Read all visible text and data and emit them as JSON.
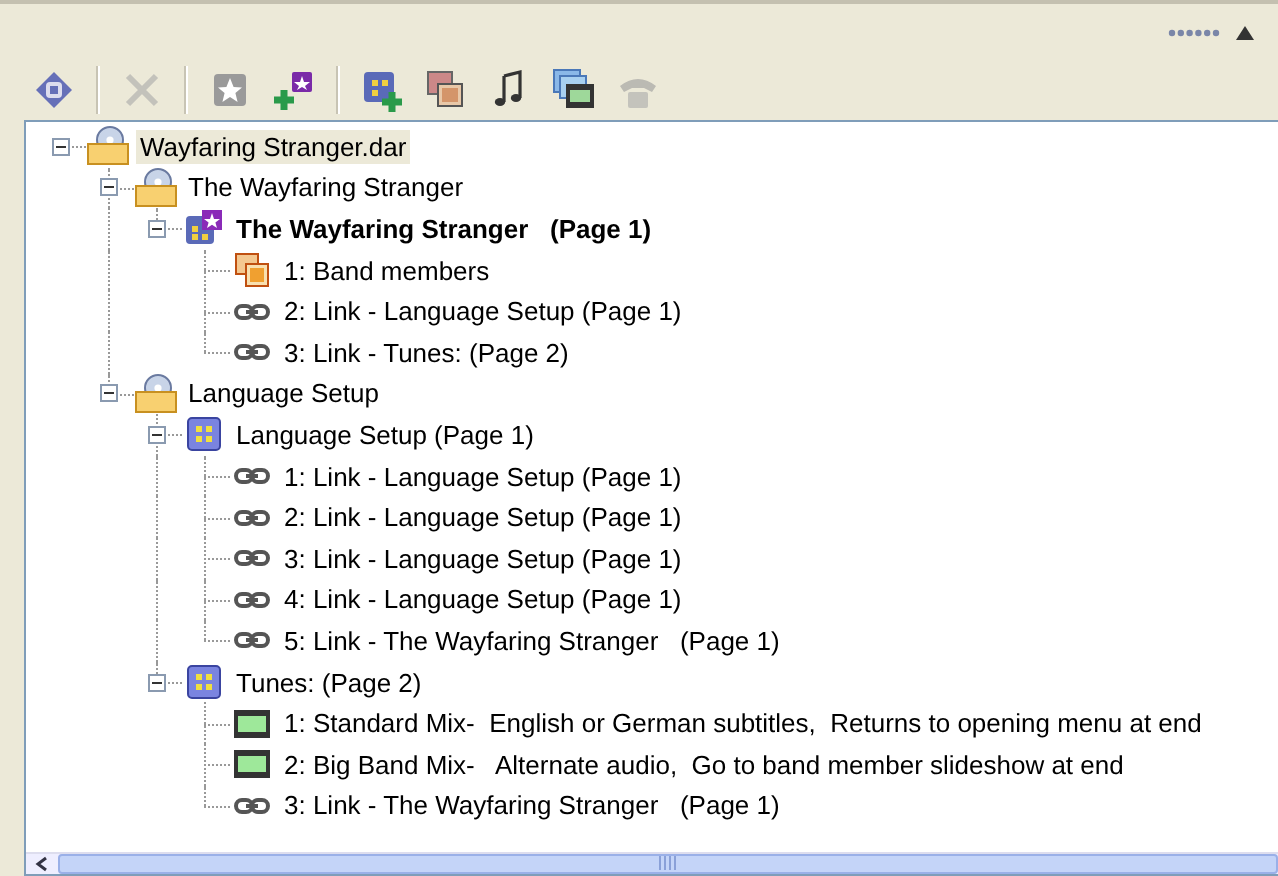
{
  "toolbar": [
    {
      "kind": "target",
      "disabled": false
    },
    {
      "kind": "separator"
    },
    {
      "kind": "delete",
      "disabled": true
    },
    {
      "kind": "separator"
    },
    {
      "kind": "star",
      "disabled": false
    },
    {
      "kind": "add-menu",
      "disabled": false
    },
    {
      "kind": "separator"
    },
    {
      "kind": "add-page",
      "disabled": false
    },
    {
      "kind": "slides",
      "disabled": false
    },
    {
      "kind": "music",
      "disabled": false
    },
    {
      "kind": "movies",
      "disabled": false
    },
    {
      "kind": "phone",
      "disabled": true
    }
  ],
  "tree": [
    {
      "kind": "disc-folder",
      "label": "Wayfaring Stranger.dar",
      "selected": true,
      "expanded": true,
      "children": [
        {
          "kind": "disc-folder",
          "label": "The Wayfaring Stranger",
          "selected": false,
          "expanded": true,
          "children": [
            {
              "kind": "start-menu",
              "label": "The Wayfaring Stranger   (Page 1)",
              "selected": false,
              "expanded": true,
              "children": [
                {
                  "kind": "slideshow",
                  "label": "1: Band members",
                  "selected": false
                },
                {
                  "kind": "link",
                  "label": "2: Link - Language Setup (Page 1)",
                  "selected": false
                },
                {
                  "kind": "link",
                  "label": "3: Link - Tunes: (Page 2)",
                  "selected": false
                }
              ]
            }
          ]
        },
        {
          "kind": "disc-folder",
          "label": "Language Setup",
          "selected": false,
          "expanded": true,
          "children": [
            {
              "kind": "menu",
              "label": "Language Setup (Page 1)",
              "selected": false,
              "expanded": true,
              "children": [
                {
                  "kind": "link",
                  "label": "1: Link - Language Setup (Page 1)",
                  "selected": false
                },
                {
                  "kind": "link",
                  "label": "2: Link - Language Setup (Page 1)",
                  "selected": false
                },
                {
                  "kind": "link",
                  "label": "3: Link - Language Setup (Page 1)",
                  "selected": false
                },
                {
                  "kind": "link",
                  "label": "4: Link - Language Setup (Page 1)",
                  "selected": false
                },
                {
                  "kind": "link",
                  "label": "5: Link - The Wayfaring Stranger   (Page 1)",
                  "selected": false
                }
              ]
            },
            {
              "kind": "menu",
              "label": "Tunes: (Page 2)",
              "selected": false,
              "expanded": true,
              "children": [
                {
                  "kind": "movie",
                  "label": "1: Standard Mix-  English or German subtitles,  Returns to opening menu at end",
                  "selected": false
                },
                {
                  "kind": "movie",
                  "label": "2: Big Band Mix-   Alternate audio,  Go to band member slideshow at end",
                  "selected": false
                },
                {
                  "kind": "link",
                  "label": "3: Link - The Wayfaring Stranger   (Page 1)",
                  "selected": false
                }
              ]
            }
          ]
        }
      ]
    }
  ]
}
